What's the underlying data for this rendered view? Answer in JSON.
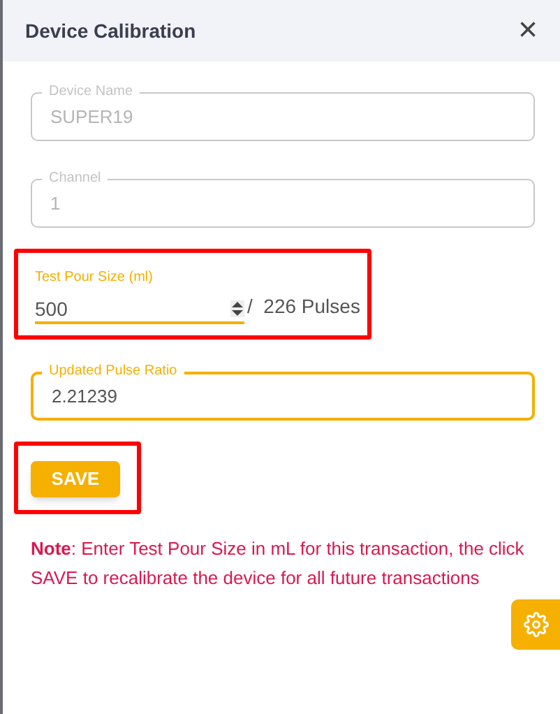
{
  "dialog": {
    "title": "Device Calibration",
    "close": "×"
  },
  "fields": [
    {
      "kind": "outlined",
      "label": "Device Name",
      "value": "SUPER19",
      "disabled": true
    },
    {
      "kind": "outlined",
      "label": "Channel",
      "value": "1",
      "disabled": true
    }
  ],
  "pour": {
    "label": "Test Pour Size (ml)",
    "value": "500",
    "suffix": "/  226 Pulses",
    "highlighted": true
  },
  "ratio": {
    "label": "Updated Pulse Ratio",
    "value": "2.21239",
    "disabled": false
  },
  "save": {
    "label": "SAVE",
    "highlighted": true
  },
  "note": "**Note**: Enter Test Pour Size in mL for this transaction, the click SAVE to recalibrate the device for all future transactions"
}
